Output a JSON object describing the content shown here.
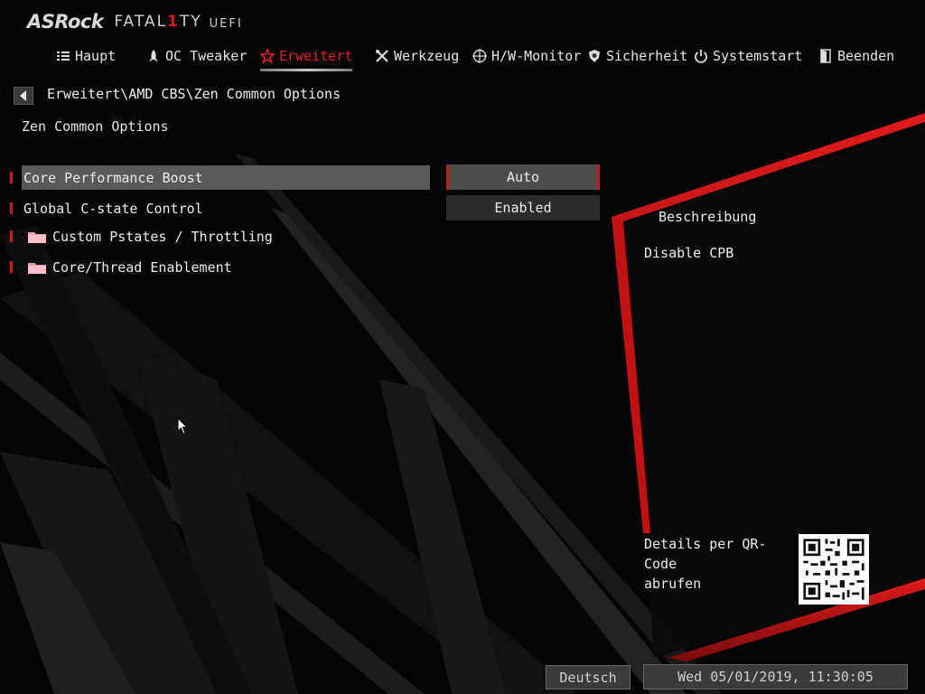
{
  "header": {
    "brand": "ASRock",
    "product_pre": "FATAL",
    "product_one": "1",
    "product_post": "TY",
    "uefi": "UEFI"
  },
  "tabs": [
    {
      "label": "Haupt",
      "icon": "list-icon"
    },
    {
      "label": "OC Tweaker",
      "icon": "rocket-icon"
    },
    {
      "label": "Erweitert",
      "icon": "star-icon",
      "active": true
    },
    {
      "label": "Werkzeug",
      "icon": "wrench-icon"
    },
    {
      "label": "H/W-Monitor",
      "icon": "target-icon"
    },
    {
      "label": "Sicherheit",
      "icon": "shield-icon"
    },
    {
      "label": "Systemstart",
      "icon": "power-icon"
    },
    {
      "label": "Beenden",
      "icon": "exit-door-icon"
    }
  ],
  "nav": {
    "breadcrumb": "Erweitert\\AMD CBS\\Zen Common Options",
    "page_title": "Zen Common Options"
  },
  "settings": [
    {
      "label": "Core Performance Boost",
      "value": "Auto",
      "selected": true
    },
    {
      "label": "Global C-state Control",
      "value": "Enabled"
    }
  ],
  "submenus": [
    {
      "label": "Custom Pstates / Throttling",
      "icon": "folder-icon"
    },
    {
      "label": "Core/Thread Enablement",
      "icon": "folder-icon"
    }
  ],
  "description": {
    "heading": "Beschreibung",
    "text": "Disable CPB"
  },
  "qr": {
    "text_line1": "Details per QR-Code",
    "text_line2": "abrufen"
  },
  "footer": {
    "language": "Deutsch",
    "datetime": "Wed 05/01/2019, 11:30:05"
  },
  "colors": {
    "accent": "#d91515",
    "background": "#060606",
    "selected_row": "#5a5a5a"
  }
}
